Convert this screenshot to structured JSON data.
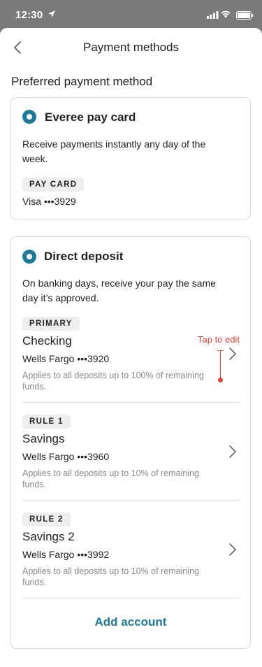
{
  "status": {
    "time": "12:30"
  },
  "header": {
    "title": "Payment methods"
  },
  "section_title": "Preferred payment method",
  "pay_card": {
    "title": "Everee pay card",
    "description_line1": "Receive payments instantly any day of the",
    "description_line2": "week.",
    "badge": "PAY CARD",
    "account": "Visa •••3929"
  },
  "direct_deposit": {
    "title": "Direct deposit",
    "description_line1": "On banking days, receive your pay the same",
    "description_line2": "day it’s approved.",
    "accounts": [
      {
        "badge": "PRIMARY",
        "name": "Checking",
        "bank": "Wells Fargo •••3920",
        "note_line1": "Applies to all deposits up to 100% of remaining",
        "note_line2": "funds."
      },
      {
        "badge": "RULE 1",
        "name": "Savings",
        "bank": "Wells Fargo •••3960",
        "note_line1": "Applies to all deposits up to 10% of remaining",
        "note_line2": "funds."
      },
      {
        "badge": "RULE 2",
        "name": "Savings 2",
        "bank": "Wells Fargo •••3992",
        "note_line1": "Applies to all deposits up to 10% of remaining",
        "note_line2": "funds."
      }
    ],
    "add_account": "Add account"
  },
  "annotation": {
    "label": "Tap to edit"
  },
  "colors": {
    "accent": "#1f7a99",
    "annotation": "#e0433a",
    "badge_bg": "#eeeeee",
    "muted_text": "#8a8a8a"
  },
  "icons": {
    "back": "chevron-left-icon",
    "row_chevron": "chevron-right-icon",
    "selected_radio": "radio-selected-icon"
  }
}
